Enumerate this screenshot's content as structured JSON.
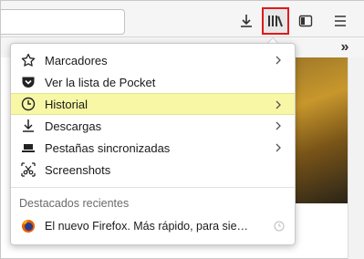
{
  "menu": {
    "items": [
      {
        "label": "Marcadores",
        "icon": "star-icon",
        "has_submenu": true
      },
      {
        "label": "Ver la lista de Pocket",
        "icon": "pocket-icon",
        "has_submenu": false
      },
      {
        "label": "Historial",
        "icon": "clock-icon",
        "has_submenu": true,
        "highlighted": true
      },
      {
        "label": "Descargas",
        "icon": "download-icon",
        "has_submenu": true
      },
      {
        "label": "Pestañas sincronizadas",
        "icon": "synced-tabs-icon",
        "has_submenu": true
      },
      {
        "label": "Screenshots",
        "icon": "scissors-icon",
        "has_submenu": false
      }
    ],
    "recent_header": "Destacados recientes",
    "recent_item": {
      "label": "El nuevo Firefox. Más rápido, para sie…",
      "icon": "firefox-icon"
    }
  },
  "colors": {
    "highlight": "#f7f7a6",
    "library_outline": "#e0191c"
  }
}
